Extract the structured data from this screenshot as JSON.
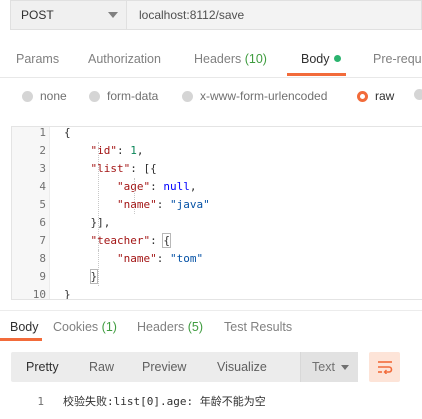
{
  "request": {
    "method": "POST",
    "url": "localhost:8112/save"
  },
  "tabs": {
    "params": "Params",
    "authorization": "Authorization",
    "headers": "Headers",
    "headers_count": "(10)",
    "body": "Body",
    "pre_request": "Pre-reque"
  },
  "body_types": {
    "none": "none",
    "form_data": "form-data",
    "urlencoded": "x-www-form-urlencoded",
    "raw": "raw",
    "selected": "raw"
  },
  "editor": {
    "line_numbers": [
      "1",
      "2",
      "3",
      "4",
      "5",
      "6",
      "7",
      "8",
      "9",
      "10"
    ],
    "lines": [
      {
        "indent": "",
        "t1": "{",
        "k": "",
        "sep": "",
        "v": "",
        "vtype": "",
        "tail": ""
      },
      {
        "indent": "    ",
        "t1": "",
        "k": "\"id\"",
        "sep": ": ",
        "v": "1",
        "vtype": "n",
        "tail": ","
      },
      {
        "indent": "    ",
        "t1": "",
        "k": "\"list\"",
        "sep": ": [{",
        "v": "",
        "vtype": "",
        "tail": ""
      },
      {
        "indent": "        ",
        "t1": "",
        "k": "\"age\"",
        "sep": ": ",
        "v": "null",
        "vtype": "kw",
        "tail": ","
      },
      {
        "indent": "        ",
        "t1": "",
        "k": "\"name\"",
        "sep": ": ",
        "v": "\"java\"",
        "vtype": "s",
        "tail": ""
      },
      {
        "indent": "    ",
        "t1": "}],",
        "k": "",
        "sep": "",
        "v": "",
        "vtype": "",
        "tail": ""
      },
      {
        "indent": "    ",
        "t1": "",
        "k": "\"teacher\"",
        "sep": ": ",
        "v": "{",
        "vtype": "box",
        "tail": ""
      },
      {
        "indent": "        ",
        "t1": "",
        "k": "\"name\"",
        "sep": ": ",
        "v": "\"tom\"",
        "vtype": "s",
        "tail": ""
      },
      {
        "indent": "    ",
        "t1": "}",
        "k": "",
        "sep": "",
        "v": "",
        "vtype": "box",
        "tail": ""
      },
      {
        "indent": "",
        "t1": "}",
        "k": "",
        "sep": "",
        "v": "",
        "vtype": "",
        "tail": ""
      }
    ]
  },
  "response_tabs": {
    "body": "Body",
    "cookies": "Cookies",
    "cookies_count": "(1)",
    "headers": "Headers",
    "headers_count": "(5)",
    "test_results": "Test Results"
  },
  "response_toolbar": {
    "pretty": "Pretty",
    "raw": "Raw",
    "preview": "Preview",
    "visualize": "Visualize",
    "format": "Text"
  },
  "response_body": {
    "line_number": "1",
    "text": "校验失败:list[0].age: 年龄不能为空"
  },
  "colors": {
    "accent": "#f26b3a",
    "active_dot": "#2bb36e",
    "count": "#3f9c3f"
  },
  "icons": {
    "method_dropdown": "chevron-down-icon",
    "format_dropdown": "chevron-down-icon",
    "wrap": "wrap-lines-icon"
  }
}
